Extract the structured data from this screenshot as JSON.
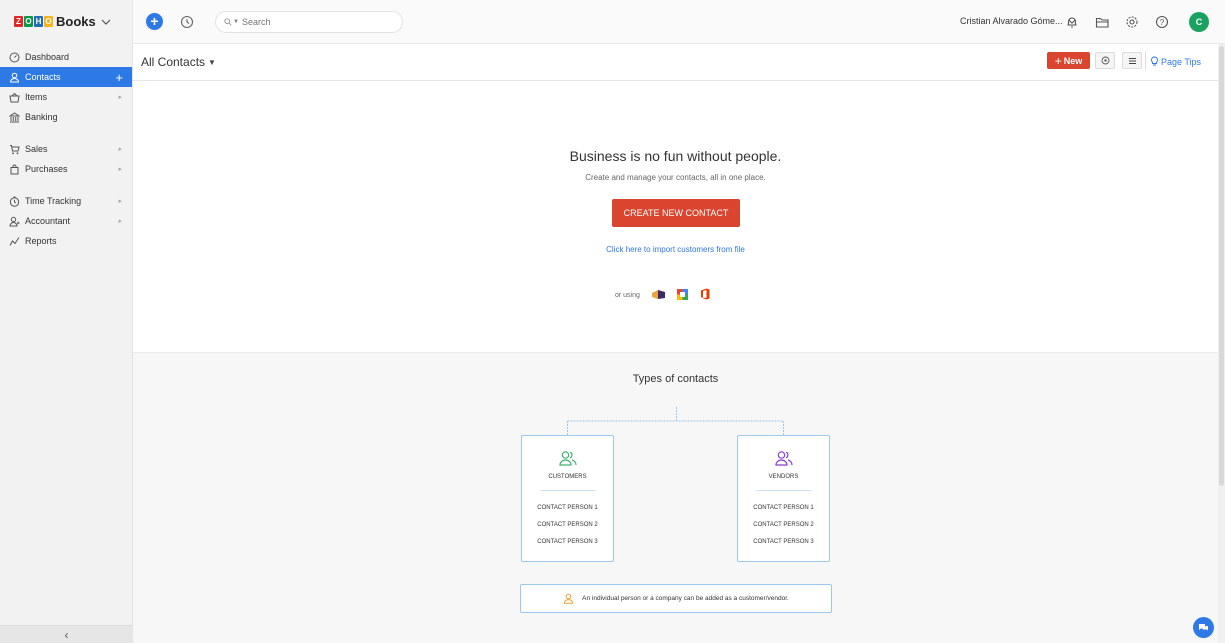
{
  "topbar": {
    "brand": "Books",
    "logo_letters": [
      "Z",
      "O",
      "H",
      "O"
    ],
    "search_placeholder": "Search",
    "user_name": "Cristian Alvarado Góme...",
    "avatar_initial": "C"
  },
  "sidebar": {
    "items": [
      {
        "label": "Dashboard",
        "icon": "dashboard-icon"
      },
      {
        "label": "Contacts",
        "icon": "contacts-icon"
      },
      {
        "label": "Items",
        "icon": "items-icon"
      },
      {
        "label": "Banking",
        "icon": "bank-icon"
      },
      {
        "label": "Sales",
        "icon": "cart-icon"
      },
      {
        "label": "Purchases",
        "icon": "bag-icon"
      },
      {
        "label": "Time Tracking",
        "icon": "clock-icon"
      },
      {
        "label": "Accountant",
        "icon": "accountant-icon"
      },
      {
        "label": "Reports",
        "icon": "reports-icon"
      }
    ],
    "collapse": "‹"
  },
  "main": {
    "view_title": "All Contacts",
    "new_button": "New",
    "page_tips": "Page Tips",
    "empty_title": "Business is no fun without people.",
    "empty_subtitle": "Create and manage your contacts, all in one place.",
    "create_button": "CREATE NEW CONTACT",
    "import_link": "Click here to import customers from file",
    "or_using": "or using",
    "types_title": "Types of contacts",
    "customers": {
      "label": "CUSTOMERS",
      "rows": [
        "CONTACT PERSON 1",
        "CONTACT PERSON 2",
        "CONTACT PERSON 3"
      ]
    },
    "vendors": {
      "label": "VENDORS",
      "rows": [
        "CONTACT PERSON 1",
        "CONTACT PERSON 2",
        "CONTACT PERSON 3"
      ]
    },
    "info_text": "An individual person or a company can be added as a customer/vendor."
  },
  "colors": {
    "accent_blue": "#2d79e6",
    "brand_red": "#d9452e",
    "customers_green": "#3bb273",
    "vendors_purple": "#8a3fd1",
    "avatar_green": "#1aa260"
  }
}
